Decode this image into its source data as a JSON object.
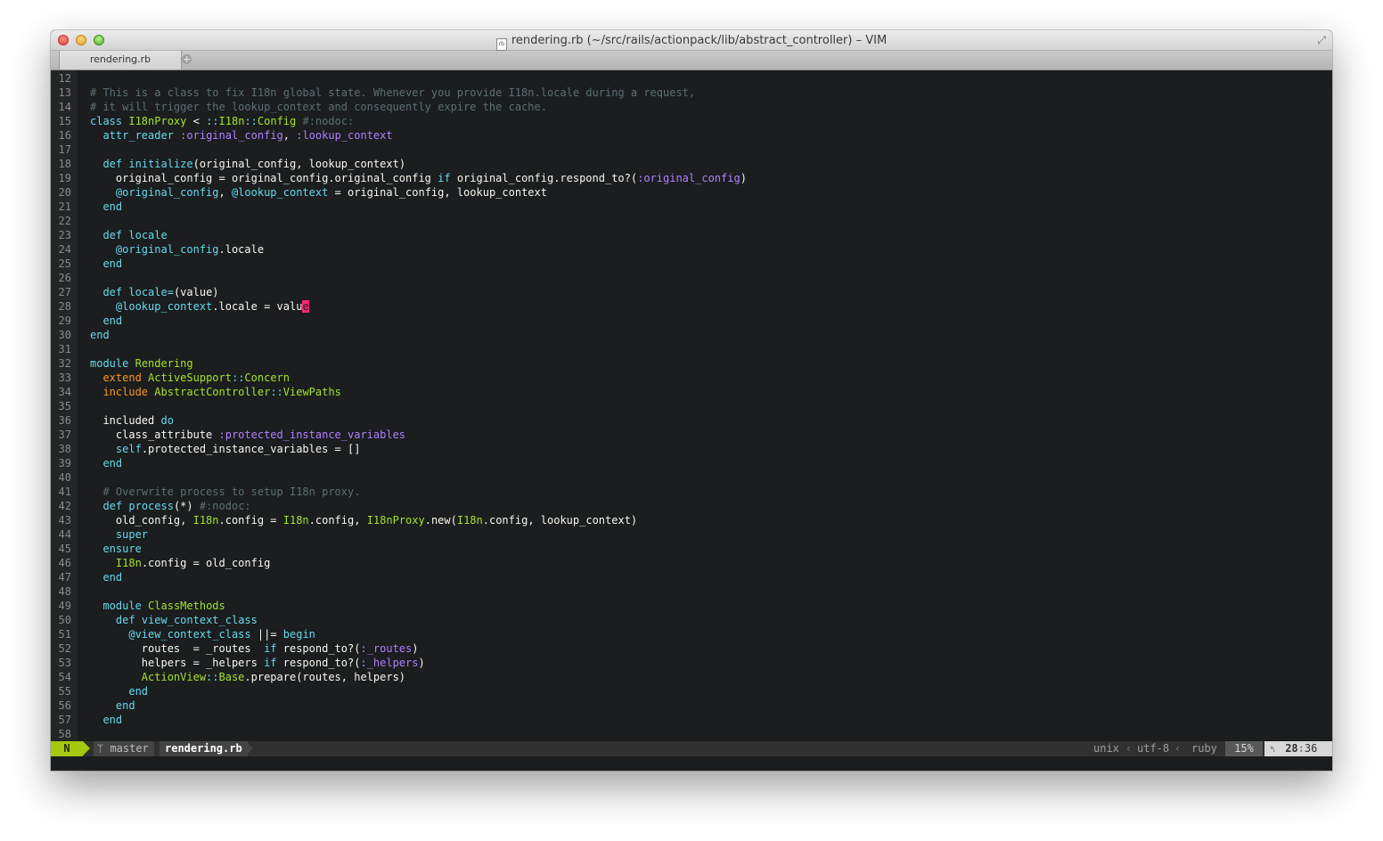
{
  "window": {
    "title": "rendering.rb (~/src/rails/actionpack/lib/abstract_controller) – VIM",
    "file_icon_label": "rb"
  },
  "tabs": [
    {
      "label": "rendering.rb"
    }
  ],
  "tab_add_label": "+",
  "editor": {
    "lines": [
      {
        "n": "12",
        "segs": []
      },
      {
        "n": "13",
        "segs": [
          [
            "cm",
            "# This is a class to fix I18n global state. Whenever you provide I18n.locale during a request,"
          ]
        ]
      },
      {
        "n": "14",
        "segs": [
          [
            "cm",
            "# it will trigger the lookup_context and consequently expire the cache."
          ]
        ]
      },
      {
        "n": "15",
        "segs": [
          [
            "kw",
            "class"
          ],
          [
            "pl",
            " "
          ],
          [
            "cl",
            "I18nProxy"
          ],
          [
            "pl",
            " < "
          ],
          [
            "kw",
            "::"
          ],
          [
            "cl",
            "I18n"
          ],
          [
            "kw",
            "::"
          ],
          [
            "cl",
            "Config"
          ],
          [
            "pl",
            " "
          ],
          [
            "cm",
            "#:nodoc:"
          ]
        ]
      },
      {
        "n": "16",
        "segs": [
          [
            "pl",
            "  "
          ],
          [
            "kw",
            "attr_reader"
          ],
          [
            "pl",
            " "
          ],
          [
            "sym",
            ":original_config"
          ],
          [
            "pl",
            ", "
          ],
          [
            "sym",
            ":lookup_context"
          ]
        ]
      },
      {
        "n": "17",
        "segs": []
      },
      {
        "n": "18",
        "segs": [
          [
            "pl",
            "  "
          ],
          [
            "kw",
            "def"
          ],
          [
            "pl",
            " "
          ],
          [
            "fn",
            "initialize"
          ],
          [
            "pl",
            "(original_config, lookup_context)"
          ]
        ]
      },
      {
        "n": "19",
        "segs": [
          [
            "pl",
            "    original_config = original_config.original_config "
          ],
          [
            "kw",
            "if"
          ],
          [
            "pl",
            " original_config.respond_to?("
          ],
          [
            "sym",
            ":original_config"
          ],
          [
            "pl",
            ")"
          ]
        ]
      },
      {
        "n": "20",
        "segs": [
          [
            "pl",
            "    "
          ],
          [
            "iv",
            "@original_config"
          ],
          [
            "pl",
            ", "
          ],
          [
            "iv",
            "@lookup_context"
          ],
          [
            "pl",
            " = original_config, lookup_context"
          ]
        ]
      },
      {
        "n": "21",
        "segs": [
          [
            "pl",
            "  "
          ],
          [
            "kw",
            "end"
          ]
        ]
      },
      {
        "n": "22",
        "segs": []
      },
      {
        "n": "23",
        "segs": [
          [
            "pl",
            "  "
          ],
          [
            "kw",
            "def"
          ],
          [
            "pl",
            " "
          ],
          [
            "fn",
            "locale"
          ]
        ]
      },
      {
        "n": "24",
        "segs": [
          [
            "pl",
            "    "
          ],
          [
            "iv",
            "@original_config"
          ],
          [
            "pl",
            ".locale"
          ]
        ]
      },
      {
        "n": "25",
        "segs": [
          [
            "pl",
            "  "
          ],
          [
            "kw",
            "end"
          ]
        ]
      },
      {
        "n": "26",
        "segs": []
      },
      {
        "n": "27",
        "segs": [
          [
            "pl",
            "  "
          ],
          [
            "kw",
            "def"
          ],
          [
            "pl",
            " "
          ],
          [
            "fn",
            "locale="
          ],
          [
            "pl",
            "(value)"
          ]
        ]
      },
      {
        "n": "28",
        "segs": [
          [
            "pl",
            "    "
          ],
          [
            "iv",
            "@lookup_context"
          ],
          [
            "pl",
            ".locale = valu"
          ],
          [
            "cursor",
            "e"
          ]
        ]
      },
      {
        "n": "29",
        "segs": [
          [
            "pl",
            "  "
          ],
          [
            "kw",
            "end"
          ]
        ]
      },
      {
        "n": "30",
        "segs": [
          [
            "kw",
            "end"
          ]
        ]
      },
      {
        "n": "31",
        "segs": []
      },
      {
        "n": "32",
        "segs": [
          [
            "kw",
            "module"
          ],
          [
            "pl",
            " "
          ],
          [
            "cl",
            "Rendering"
          ]
        ]
      },
      {
        "n": "33",
        "segs": [
          [
            "pl",
            "  "
          ],
          [
            "inc",
            "extend"
          ],
          [
            "pl",
            " "
          ],
          [
            "cl",
            "ActiveSupport"
          ],
          [
            "kw",
            "::"
          ],
          [
            "cl",
            "Concern"
          ]
        ]
      },
      {
        "n": "34",
        "segs": [
          [
            "pl",
            "  "
          ],
          [
            "inc",
            "include"
          ],
          [
            "pl",
            " "
          ],
          [
            "cl",
            "AbstractController"
          ],
          [
            "kw",
            "::"
          ],
          [
            "cl",
            "ViewPaths"
          ]
        ]
      },
      {
        "n": "35",
        "segs": []
      },
      {
        "n": "36",
        "segs": [
          [
            "pl",
            "  included "
          ],
          [
            "kw",
            "do"
          ]
        ]
      },
      {
        "n": "37",
        "segs": [
          [
            "pl",
            "    class_attribute "
          ],
          [
            "sym",
            ":protected_instance_variables"
          ]
        ]
      },
      {
        "n": "38",
        "segs": [
          [
            "pl",
            "    "
          ],
          [
            "kw",
            "self"
          ],
          [
            "pl",
            ".protected_instance_variables = []"
          ]
        ]
      },
      {
        "n": "39",
        "segs": [
          [
            "pl",
            "  "
          ],
          [
            "kw",
            "end"
          ]
        ]
      },
      {
        "n": "40",
        "segs": []
      },
      {
        "n": "41",
        "segs": [
          [
            "pl",
            "  "
          ],
          [
            "cm",
            "# Overwrite process to setup I18n proxy."
          ]
        ]
      },
      {
        "n": "42",
        "segs": [
          [
            "pl",
            "  "
          ],
          [
            "kw",
            "def"
          ],
          [
            "pl",
            " "
          ],
          [
            "fn",
            "process"
          ],
          [
            "pl",
            "(*) "
          ],
          [
            "cm",
            "#:nodoc:"
          ]
        ]
      },
      {
        "n": "43",
        "segs": [
          [
            "pl",
            "    old_config, "
          ],
          [
            "cl",
            "I18n"
          ],
          [
            "pl",
            ".config = "
          ],
          [
            "cl",
            "I18n"
          ],
          [
            "pl",
            ".config, "
          ],
          [
            "cl",
            "I18nProxy"
          ],
          [
            "pl",
            ".new("
          ],
          [
            "cl",
            "I18n"
          ],
          [
            "pl",
            ".config, lookup_context)"
          ]
        ]
      },
      {
        "n": "44",
        "segs": [
          [
            "pl",
            "    "
          ],
          [
            "kw",
            "super"
          ]
        ]
      },
      {
        "n": "45",
        "segs": [
          [
            "pl",
            "  "
          ],
          [
            "kw",
            "ensure"
          ]
        ]
      },
      {
        "n": "46",
        "segs": [
          [
            "pl",
            "    "
          ],
          [
            "cl",
            "I18n"
          ],
          [
            "pl",
            ".config = old_config"
          ]
        ]
      },
      {
        "n": "47",
        "segs": [
          [
            "pl",
            "  "
          ],
          [
            "kw",
            "end"
          ]
        ]
      },
      {
        "n": "48",
        "segs": []
      },
      {
        "n": "49",
        "segs": [
          [
            "pl",
            "  "
          ],
          [
            "kw",
            "module"
          ],
          [
            "pl",
            " "
          ],
          [
            "cl",
            "ClassMethods"
          ]
        ]
      },
      {
        "n": "50",
        "segs": [
          [
            "pl",
            "    "
          ],
          [
            "kw",
            "def"
          ],
          [
            "pl",
            " "
          ],
          [
            "fn",
            "view_context_class"
          ]
        ]
      },
      {
        "n": "51",
        "segs": [
          [
            "pl",
            "      "
          ],
          [
            "iv",
            "@view_context_class"
          ],
          [
            "pl",
            " ||= "
          ],
          [
            "kw",
            "begin"
          ]
        ]
      },
      {
        "n": "52",
        "segs": [
          [
            "pl",
            "        routes  = _routes  "
          ],
          [
            "kw",
            "if"
          ],
          [
            "pl",
            " respond_to?("
          ],
          [
            "sym",
            ":_routes"
          ],
          [
            "pl",
            ")"
          ]
        ]
      },
      {
        "n": "53",
        "segs": [
          [
            "pl",
            "        helpers = _helpers "
          ],
          [
            "kw",
            "if"
          ],
          [
            "pl",
            " respond_to?("
          ],
          [
            "sym",
            ":_helpers"
          ],
          [
            "pl",
            ")"
          ]
        ]
      },
      {
        "n": "54",
        "segs": [
          [
            "pl",
            "        "
          ],
          [
            "cl",
            "ActionView"
          ],
          [
            "kw",
            "::"
          ],
          [
            "cl",
            "Base"
          ],
          [
            "pl",
            ".prepare(routes, helpers)"
          ]
        ]
      },
      {
        "n": "55",
        "segs": [
          [
            "pl",
            "      "
          ],
          [
            "kw",
            "end"
          ]
        ]
      },
      {
        "n": "56",
        "segs": [
          [
            "pl",
            "    "
          ],
          [
            "kw",
            "end"
          ]
        ]
      },
      {
        "n": "57",
        "segs": [
          [
            "pl",
            "  "
          ],
          [
            "kw",
            "end"
          ]
        ]
      },
      {
        "n": "58",
        "segs": []
      }
    ]
  },
  "statusbar": {
    "mode": "N",
    "branch": "master",
    "branch_icon": "branch-icon",
    "filename": "rendering.rb",
    "fileformat": "unix",
    "encoding": "utf-8",
    "filetype": "ruby",
    "percent": "15%",
    "line_icon": "line-number-icon",
    "line": "28",
    "col": "36"
  },
  "colors": {
    "background": "#1b1d1e",
    "keyword": "#66d9ef",
    "class": "#a6e22e",
    "symbol": "#ae81ff",
    "include": "#fd971f",
    "comment": "#5f6f74",
    "cursor": "#f92672",
    "mode_bg": "#a6c80e"
  }
}
